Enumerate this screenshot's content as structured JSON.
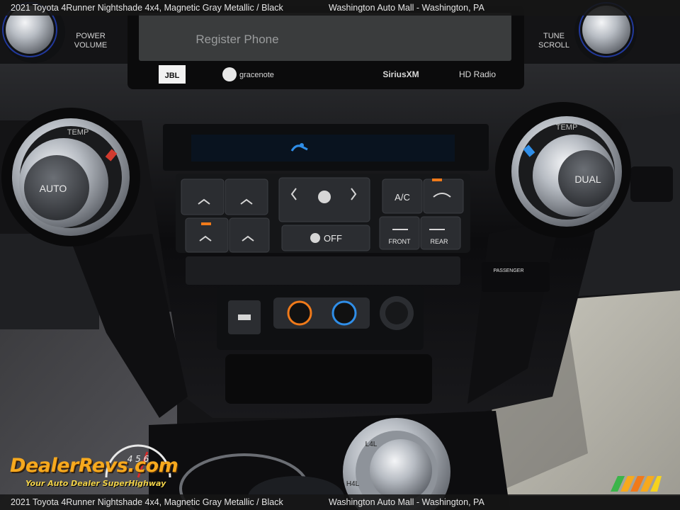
{
  "caption": {
    "vehicle": "2021 Toyota 4Runner Nightshade 4x4,  Magnetic Gray Metallic / Black",
    "dealer": "Washington Auto Mall - Washington, PA"
  },
  "screen": {
    "message": "Register Phone",
    "brands": [
      "JBL",
      "gracenote",
      "SiriusXM",
      "HD Radio"
    ]
  },
  "controls": {
    "power_volume": "POWER\nVOLUME",
    "tune_scroll": "TUNE\nSCROLL",
    "left_knob_ring": "TEMP",
    "left_knob_label": "AUTO",
    "right_knob_ring": "TEMP",
    "right_knob_label": "DUAL",
    "ac_label": "A/C",
    "fan_off_label": "OFF",
    "front_label": "FRONT",
    "rear_label": "REAR",
    "passenger_label": "PASSENGER"
  },
  "transfer_case": {
    "upper": "L4L",
    "lower": "H4L"
  },
  "watermark": {
    "brand": "DealerRevs.com",
    "tagline": "Your Auto Dealer SuperHighway",
    "gauge_digits": "4 5 6"
  },
  "colors": {
    "bezel": "#121315",
    "gloss_black": "#0b0b0d",
    "chrome": "#c9cdd2",
    "lcd_blue": "#2f8ee8",
    "indicator_orange": "#f07a1a",
    "brand_orange": "#f6a91e",
    "carpet": "#4a4a4c"
  }
}
